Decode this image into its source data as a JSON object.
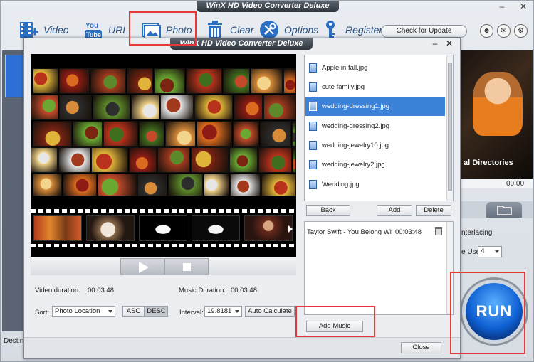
{
  "main_window": {
    "title": "WinX HD Video Converter Deluxe",
    "controls": {
      "minimize": "–",
      "close": "✕"
    },
    "toolbar": [
      {
        "label": "Video",
        "icon": "film-plus-icon"
      },
      {
        "label": "URL",
        "icon": "youtube-icon",
        "icon_text": "You\nTube"
      },
      {
        "label": "Photo",
        "icon": "photo-icon"
      },
      {
        "label": "Clear",
        "icon": "trash-icon"
      },
      {
        "label": "Options",
        "icon": "wrench-icon"
      },
      {
        "label": "Register",
        "icon": "key-icon"
      }
    ],
    "check_update_label": "Check for Update",
    "user_icon": "user-icon",
    "mail_icon": "mail-icon",
    "settings_icon": "settings-icon",
    "preview_caption": "al Directories",
    "time_display": "00:00",
    "deinterlacing_label": "nterlacing",
    "core_use_label": "e Use:",
    "core_use_value": "4",
    "run_label": "RUN",
    "destination_label": "Destina"
  },
  "dialog": {
    "title": "WinX HD Video Converter Deluxe",
    "controls": {
      "minimize": "–",
      "close": "✕"
    },
    "files": [
      {
        "name": "Apple in fall.jpg",
        "selected": false
      },
      {
        "name": "cute family.jpg",
        "selected": false
      },
      {
        "name": "wedding-dressing1.jpg",
        "selected": true
      },
      {
        "name": "wedding-dressing2.jpg",
        "selected": false
      },
      {
        "name": "wedding-jewelry10.jpg",
        "selected": false
      },
      {
        "name": "wedding-jewelry2.jpg",
        "selected": false
      },
      {
        "name": "Wedding.jpg",
        "selected": false
      }
    ],
    "back_label": "Back",
    "add_label": "Add",
    "delete_label": "Delete",
    "music": {
      "title": "Taylor Swift - You Belong With Me",
      "duration": "00:03:48"
    },
    "add_music_label": "Add Music",
    "video_duration_label": "Video duration:",
    "video_duration_value": "00:03:48",
    "music_duration_label": "Music Duration:",
    "music_duration_value": "00:03:48",
    "sort_label": "Sort:",
    "sort_value": "Photo Location",
    "asc_label": "ASC",
    "desc_label": "DESC",
    "interval_label": "Interval:",
    "interval_value": "19.8181",
    "auto_calculate_label": "Auto Calculate",
    "close_label": "Close"
  },
  "colors": {
    "accent_blue": "#3b82d8",
    "highlight_red": "#e53939",
    "run_blue": "#0d5fd2"
  }
}
